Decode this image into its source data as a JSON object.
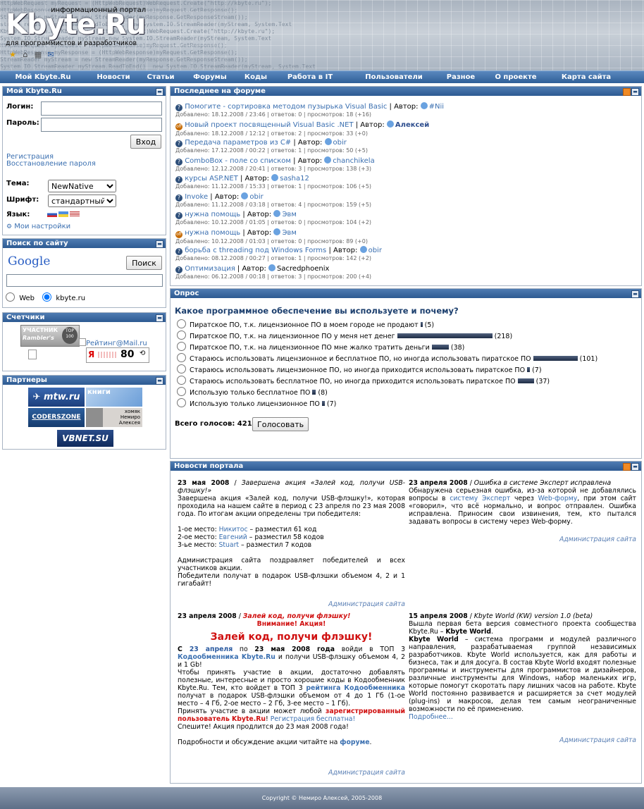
{
  "header": {
    "tagline_top": "информационный портал",
    "logo": "Kbyte.Ru",
    "tagline_bottom": "для программистов и разработчиков",
    "code_lines": [
      "HttpWebRequest myRequest = (HttpWebRequest)WebRequest.Create(\"http://kbyte.ru\");",
      "HttpWebResponse myResponse = (HttpWebResponse)myRequest.GetResponse();",
      "StreamReader myStream = new StreamReader(myResponse.GetResponseStream());",
      "string result = myStream.ReadToEnd(); new System.IO.StreamReader(myStream, System.Text",
      "Kbyte.Ru.Kbyte.Ru.Kbyte.Ru  (HttpWebRequest)WebRequest.Create(\"http://kbyte.ru\");",
      "System.IO.StreamReader myStream new System.IO.StreamReader(myStream, System.Text",
      "HttpWebRequest myRequest  (HttpWebResponse)myRequest.GetResponse();",
      "HttpWebResponse myResponse = (HttpWebResponse)myRequest.GetResponse();",
      "StreamReader myStream = new StreamReader(myResponse.GetResponseStream());",
      "System.IO.StreamReader myStream.ReadToEnd()  new System.IO.StreamReader(myStream, System.Text"
    ]
  },
  "nav": [
    "Мой Kbyte.Ru",
    "Новости",
    "Статьи",
    "Форумы",
    "Коды",
    "Работа в IT",
    "Пользователи",
    "Разное",
    "О проекте",
    "Карта сайта"
  ],
  "login": {
    "title": "Мой Kbyte.Ru",
    "login_label": "Логин:",
    "password_label": "Пароль:",
    "submit": "Вход",
    "register": "Регистрация",
    "restore": "Восстановление пароля",
    "theme_label": "Тема:",
    "theme_value": "NewNative",
    "font_label": "Шрифт:",
    "font_value": "стандартный",
    "lang_label": "Язык:",
    "settings": "Мои настройки"
  },
  "search": {
    "title": "Поиск по сайту",
    "google": "Google",
    "button": "Поиск",
    "opt_web": "Web",
    "opt_site": "kbyte.ru"
  },
  "counters": {
    "title": "Счетчики",
    "rambler_top": "УЧАСТНИК",
    "rambler_bottom": "Rambler's",
    "rambler_num": "TOP 100",
    "mailru": "Рейтинг@Mail.ru",
    "ya_num": "80"
  },
  "partners": {
    "title": "Партнеры",
    "mtw": "mtw.ru",
    "knigi": "книги",
    "coders": "CODERSZONE",
    "nemiro_line1": "хомяк",
    "nemiro_line2": "Немиро",
    "nemiro_line3": "Алексея",
    "vbnet": "VBNET.SU"
  },
  "forum": {
    "title": "Последнее на форуме",
    "author_label": "Автор:",
    "items": [
      {
        "icon": "q",
        "title": "Помогите - сортировка методом пузырька Visual Basic",
        "author": "#Nii",
        "meta": "Добавлено: 18.12.2008 / 23:46 | ответов: 0 | просмотров: 18 (+16)"
      },
      {
        "icon": "off",
        "title": "Новый проект посвященный Visual Basic .NET",
        "author": "Алексей",
        "meta": "Добавлено: 18.12.2008 / 12:12 | ответов: 2 | просмотров: 33 (+0)"
      },
      {
        "icon": "q",
        "title": "Передача параметров из C#",
        "author": "obir",
        "meta": "Добавлено: 17.12.2008 / 00:22 | ответов: 1 | просмотров: 50 (+5)"
      },
      {
        "icon": "q",
        "title": "ComboBox - поле со списком",
        "author": "chanchikela",
        "meta": "Добавлено: 12.12.2008 / 20:41 | ответов: 3 | просмотров: 138 (+3)"
      },
      {
        "icon": "q",
        "title": "курсы ASP.NET",
        "author": "sasha12",
        "meta": "Добавлено: 11.12.2008 / 15:33 | ответов: 1 | просмотров: 106 (+5)"
      },
      {
        "icon": "q",
        "title": "Invoke",
        "author": "obir",
        "meta": "Добавлено: 11.12.2008 / 03:18 | ответов: 4 | просмотров: 159 (+5)"
      },
      {
        "icon": "q",
        "title": "нужна помощь",
        "author": "Эвм",
        "meta": "Добавлено: 10.12.2008 / 01:05 | ответов: 0 | просмотров: 104 (+2)"
      },
      {
        "icon": "off",
        "title": "нужна помощь",
        "author": "Эвм",
        "meta": "Добавлено: 10.12.2008 / 01:03 | ответов: 0 | просмотров: 89 (+0)"
      },
      {
        "icon": "q",
        "title": "борьба с threading под Windows Forms",
        "author": "obir",
        "meta": "Добавлено: 08.12.2008 / 00:27 | ответов: 1 | просмотров: 142 (+2)"
      },
      {
        "icon": "q",
        "title": "Оптимизация",
        "author": "Sacredphoenix",
        "meta": "Добавлено: 06.12.2008 / 00:18 | ответов: 3 | просмотров: 200 (+4)"
      }
    ]
  },
  "poll": {
    "title": "Опрос",
    "question": "Какое программное обеспечение вы используете и почему?",
    "options": [
      {
        "text": "Пиратское ПО, т.к. лицензионное ПО в моем городе не продают",
        "votes": "(5)",
        "count": 5
      },
      {
        "text": "Пиратское ПО, т.к. на лицензионное ПО у меня нет денег",
        "votes": "(218)",
        "count": 218
      },
      {
        "text": "Пиратское ПО, т.к. на лицензионное ПО мне жалко тратить деньги",
        "votes": "(38)",
        "count": 38
      },
      {
        "text": "Стараюсь использовать лицензионное и бесплатное ПО, но иногда использовать пиратское ПО",
        "votes": "(101)",
        "count": 101
      },
      {
        "text": "Стараюсь использовать лицензионное ПО, но иногда приходится использовать пиратское ПО",
        "votes": "(7)",
        "count": 7
      },
      {
        "text": "Стараюсь использовать бесплатное ПО, но иногда приходится использовать пиратское ПО",
        "votes": "(37)",
        "count": 37
      },
      {
        "text": "Использую только бесплатное ПО",
        "votes": "(8)",
        "count": 8
      },
      {
        "text": "Использую только лицензионное ПО",
        "votes": "(7)",
        "count": 7
      }
    ],
    "total_label": "Всего голосов: 421",
    "vote_button": "Голосовать"
  },
  "news": {
    "title": "Новости портала",
    "n1_date": "23 мая 2008",
    "n1_title": "Завершена акция «Залей код, получи USB-флэшку!»",
    "n1_p1": "Завершена акция «Залей код, получи USB-флэшку!», которая проходила на нашем сайте в период с 23 апреля по 23 мая 2008 года. По итогам акции определены три победителя:",
    "n1_w1a": "1-ое место: ",
    "n1_w1b": "Никитос",
    "n1_w1c": " – разместил 61 код",
    "n1_w2a": "2-ое место: ",
    "n1_w2b": "Евгений",
    "n1_w2c": " – разместил 58 кодов",
    "n1_w3a": "3-ье место: ",
    "n1_w3b": "Stuart",
    "n1_w3c": " – разместил 7 кодов",
    "n1_p2": "Администрация сайта поздравляет победителей и всех участников акции.",
    "n1_p3": "Победители получат в подарок USB-флэшки объемом 4, 2 и 1 гигабайт!",
    "admin": "Администрация сайта",
    "n2_date": "23 апреля 2008",
    "n2_title": "Ошибка в системе Эксперт исправлена",
    "n2_p1a": "Обнаружена серьезная ошибка, из-за которой не добавлялись вопросы в ",
    "n2_p1b": "систему Эксперт",
    "n2_p1c": " через ",
    "n2_p1d": "Web-форму",
    "n2_p1e": ", при этом сайт «говорил», что всё нормально, и вопрос отправлен. Ошибка исправлена. Приносим свои извинения, тем, кто пытался задавать вопросы в систему через Web-форму.",
    "n3_date": "23 апреля 2008",
    "n3_title": "Залей код, получи флэшку!",
    "n3_warn": "Внимание! Акция!",
    "n3_big": "Залей код, получи флэшку!",
    "n3_p1a": "С ",
    "n3_p1b": "23 апреля",
    "n3_p1c": " по ",
    "n3_p1d": "23 мая 2008 года",
    "n3_p1e": " войди в ТОП 3 ",
    "n3_p1f": "Кодообменника Kbyte.Ru",
    "n3_p1g": " и получи USB-флэшку объемом 4, 2 и 1 Gb!",
    "n3_p2a": "Чтобы принять участие в акции, достаточно добавлять полезные, интересные и просто хорошие коды в Кодообменник Kbyte.Ru. Тем, кто войдет в ТОП 3 ",
    "n3_p2b": "рейтинга Кодообменника",
    "n3_p2c": " получат в подарок USB-флэшки объемом от 4 до 1 Гб (1-ое место – 4 Гб, 2-ое место – 2 Гб, 3-ее место – 1 Гб).",
    "n3_p3a": "Принять участие в акции может любой ",
    "n3_p3b": "зарегистрированный пользователь Kbyte.Ru",
    "n3_p3c": "! ",
    "n3_p3d": "Регистрация бесплатна!",
    "n3_p4": "Спешите! Акция продлится до 23 мая 2008 года!",
    "n3_p5a": "Подробности и обсуждение акции читайте на ",
    "n3_p5b": "форуме",
    "n3_p5c": ".",
    "n4_date": "15 апреля 2008",
    "n4_title": "Kbyte World (KW) version 1.0 (beta)",
    "n4_p1a": "Вышла первая бета версия совместного проекта сообщества Kbyte.Ru – ",
    "n4_p1b": "Kbyte World",
    "n4_p1c": ".",
    "n4_p2a": "Kbyte World",
    "n4_p2b": " – система программ и модулей различного направления, разрабатываемая группой независимых разработчиков. Kbyte World используется, как для работы и бизнеса, так и для досуга. В состав Kbyte World входят полезные программы и инструменты для программистов и дизайнеров, различные инструменты для Windows, набор маленьких игр, которые помогут скоротать пару лишних часов на работе. Kbyte World постоянно развивается и расширяется за счет модулей (plug-ins) и макросов, делая тем самым неограниченные возможности по её применению.",
    "n4_more": "Подробнее..."
  },
  "footer": "Copyright © Немиро Алексей, 2005-2008"
}
